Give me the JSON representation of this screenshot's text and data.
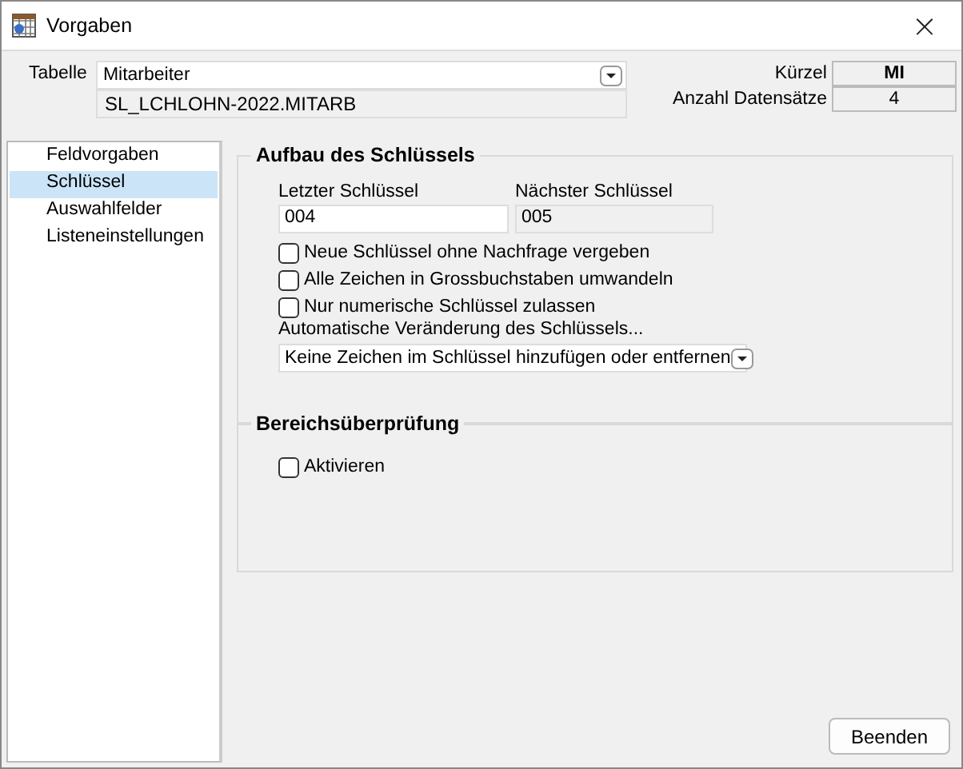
{
  "window": {
    "title": "Vorgaben",
    "close": "×"
  },
  "header": {
    "table_label": "Tabelle",
    "table_value": "Mitarbeiter",
    "table_path": "SL_LCHLOHN-2022.MITARB",
    "short_label": "Kürzel",
    "short_value": "MI",
    "count_label": "Anzahl Datensätze",
    "count_value": "4"
  },
  "sidebar": {
    "items": [
      {
        "label": "Feldvorgaben",
        "selected": false
      },
      {
        "label": "Schlüssel",
        "selected": true
      },
      {
        "label": "Auswahlfelder",
        "selected": false
      },
      {
        "label": "Listeneinstellungen",
        "selected": false
      }
    ]
  },
  "key_group": {
    "title": "Aufbau des Schlüssels",
    "last_label": "Letzter Schlüssel",
    "last_value": "004",
    "next_label": "Nächster Schlüssel",
    "next_value": "005",
    "options": [
      {
        "label": "Neue Schlüssel ohne Nachfrage vergeben",
        "checked": false
      },
      {
        "label": "Alle Zeichen in Grossbuchstaben umwandeln",
        "checked": false
      },
      {
        "label": "Nur numerische Schlüssel zulassen",
        "checked": false
      }
    ],
    "auto_label": "Automatische Veränderung des Schlüssels...",
    "auto_value": "Keine Zeichen im Schlüssel hinzufügen oder entfernen"
  },
  "range_group": {
    "title": "Bereichsüberprüfung",
    "option": {
      "label": "Aktivieren",
      "checked": false
    }
  },
  "buttons": [
    "Beenden"
  ]
}
